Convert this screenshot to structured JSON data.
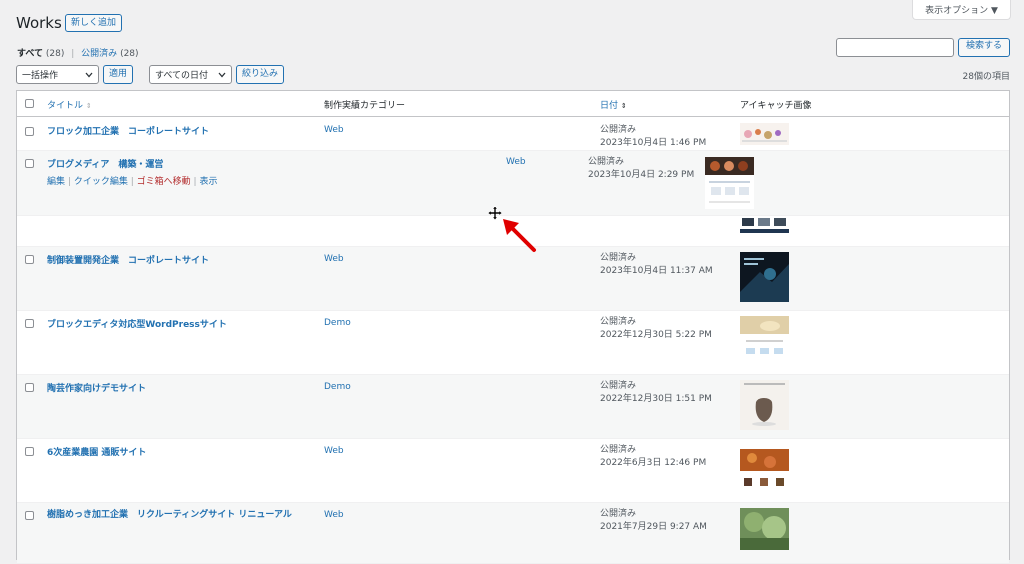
{
  "header": {
    "title": "Works",
    "add_new": "新しく追加",
    "screen_options": "表示オプション ▼"
  },
  "views": {
    "all_label": "すべて",
    "all_count": "(28)",
    "published_label": "公開済み",
    "published_count": "(28)",
    "separator": "|"
  },
  "search": {
    "button": "検索する",
    "placeholder": ""
  },
  "toolbar": {
    "bulk": "一括操作",
    "apply": "適用",
    "dates": "すべての日付",
    "filter": "絞り込み",
    "count": "28個の項目"
  },
  "columns": {
    "title": "タイトル",
    "category": "制作実績カテゴリー",
    "date": "日付",
    "image": "アイキャッチ画像"
  },
  "row_actions": {
    "edit": "編集",
    "quick_edit": "クイック編集",
    "trash": "ゴミ箱へ移動",
    "view": "表示",
    "sep": "|"
  },
  "rows": [
    {
      "title": "フロック加工企業　コーポレートサイト",
      "category": "Web",
      "status": "公開済み",
      "date": "2023年10月4日 1:46 PM"
    },
    {
      "title": "ブログメディア　構築・運営",
      "category": "Web",
      "status": "公開済み",
      "date": "2023年10月4日 2:29 PM"
    },
    {
      "title": "制御装置開発企業　コーポレートサイト",
      "category": "Web",
      "status": "公開済み",
      "date": "2023年10月4日 11:37 AM"
    },
    {
      "title": "ブロックエディタ対応型WordPressサイト",
      "category": "Demo",
      "status": "公開済み",
      "date": "2022年12月30日 5:22 PM"
    },
    {
      "title": "陶芸作家向けデモサイト",
      "category": "Demo",
      "status": "公開済み",
      "date": "2022年12月30日 1:51 PM"
    },
    {
      "title": "6次産業農園 通販サイト",
      "category": "Web",
      "status": "公開済み",
      "date": "2022年6月3日 12:46 PM"
    },
    {
      "title": "樹脂めっき加工企業　リクルーティングサイト リニューアル",
      "category": "Web",
      "status": "公開済み",
      "date": "2021年7月29日 9:27 AM"
    }
  ],
  "icons": {
    "sort": "sort-icon",
    "move_cursor": "move-cursor-icon",
    "arrow": "red-arrow-icon"
  },
  "colors": {
    "link": "#2271b1",
    "trash": "#b32d2e",
    "arrow": "#e00000"
  }
}
